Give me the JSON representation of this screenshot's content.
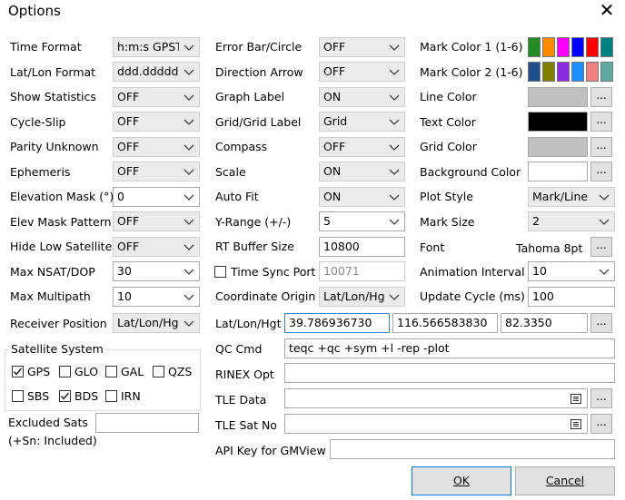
{
  "window": {
    "title": "Options"
  },
  "col1": {
    "time_format": {
      "label": "Time Format",
      "value": "h:m:s GPST"
    },
    "latlon_format": {
      "label": "Lat/Lon Format",
      "value": "ddd.ddddd"
    },
    "show_statistics": {
      "label": "Show Statistics",
      "value": "OFF"
    },
    "cycle_slip": {
      "label": "Cycle-Slip",
      "value": "OFF"
    },
    "parity_unknown": {
      "label": "Parity Unknown",
      "value": "OFF"
    },
    "ephemeris": {
      "label": "Ephemeris",
      "value": "OFF"
    },
    "elevation_mask": {
      "label": "Elevation Mask (°)",
      "value": "0"
    },
    "elev_mask_pattern": {
      "label": "Elev Mask Pattern",
      "value": "OFF"
    },
    "hide_low_satellite": {
      "label": "Hide Low Satellite",
      "value": "OFF"
    },
    "max_nsat_dop": {
      "label": "Max NSAT/DOP",
      "value": "30"
    },
    "max_multipath": {
      "label": "Max Multipath",
      "value": "10"
    },
    "receiver_position": {
      "label": "Receiver Position",
      "value": "Lat/Lon/Hg"
    }
  },
  "col2": {
    "error_bar": {
      "label": "Error Bar/Circle",
      "value": "OFF"
    },
    "direction_arrow": {
      "label": "Direction Arrow",
      "value": "OFF"
    },
    "graph_label": {
      "label": "Graph Label",
      "value": "ON"
    },
    "grid_label": {
      "label": "Grid/Grid Label",
      "value": "Grid"
    },
    "compass": {
      "label": "Compass",
      "value": "OFF"
    },
    "scale": {
      "label": "Scale",
      "value": "ON"
    },
    "auto_fit": {
      "label": "Auto Fit",
      "value": "ON"
    },
    "y_range": {
      "label": "Y-Range (+/-)",
      "value": "5"
    },
    "rt_buffer_size": {
      "label": "RT Buffer Size",
      "value": "10800"
    },
    "time_sync_port": {
      "label": "Time Sync Port",
      "value": "10071",
      "checked": false
    },
    "coordinate_origin": {
      "label": "Coordinate Origin",
      "value": "Lat/Lon/Hg"
    }
  },
  "col3": {
    "mark_color_1": {
      "label": "Mark Color 1 (1-6)",
      "colors": [
        "#228b22",
        "#ff8c00",
        "#ff00ff",
        "#0000ff",
        "#ff0000",
        "#008080"
      ]
    },
    "mark_color_2": {
      "label": "Mark Color 2 (1-6)",
      "colors": [
        "#1e4f8c",
        "#808000",
        "#8a2be2",
        "#1e90ff",
        "#f08080",
        "#5fa8a0"
      ]
    },
    "line_color": {
      "label": "Line Color",
      "color": "#c0c0c0",
      "btn": "..."
    },
    "text_color": {
      "label": "Text Color",
      "color": "#000000",
      "btn": "..."
    },
    "grid_color": {
      "label": "Grid Color",
      "color": "#c0c0c0",
      "btn": "..."
    },
    "background_color": {
      "label": "Background Color",
      "color": "#ffffff",
      "btn": "..."
    },
    "plot_style": {
      "label": "Plot Style",
      "value": "Mark/Line"
    },
    "mark_size": {
      "label": "Mark Size",
      "value": "2"
    },
    "font": {
      "label": "Font",
      "value": "Tahoma 8pt",
      "btn": "..."
    },
    "animation_interval": {
      "label": "Animation Interval",
      "value": "10"
    },
    "update_cycle": {
      "label": "Update Cycle (ms)",
      "value": "100"
    }
  },
  "latlonhgt": {
    "label": "Lat/Lon/Hgt",
    "lat": "39.786936730",
    "lon": "116.566583830",
    "hgt": "82.3350",
    "btn": "..."
  },
  "qc_cmd": {
    "label": "QC Cmd",
    "value": "teqc +qc +sym +l -rep -plot"
  },
  "rinex_opt": {
    "label": "RINEX Opt",
    "value": ""
  },
  "tle_data": {
    "label": "TLE Data",
    "value": "",
    "btn": "..."
  },
  "tle_sat_no": {
    "label": "TLE Sat No",
    "value": "",
    "btn": "..."
  },
  "api_key": {
    "label": "API Key for GMView",
    "value": ""
  },
  "satellite_system": {
    "title": "Satellite System",
    "gps": {
      "label": "GPS",
      "checked": true
    },
    "glo": {
      "label": "GLO",
      "checked": false
    },
    "gal": {
      "label": "GAL",
      "checked": false
    },
    "qzs": {
      "label": "QZS",
      "checked": false
    },
    "sbs": {
      "label": "SBS",
      "checked": false
    },
    "bds": {
      "label": "BDS",
      "checked": true
    },
    "irn": {
      "label": "IRN",
      "checked": false
    }
  },
  "excluded_sats": {
    "label_line1": "Excluded Sats",
    "label_line2": "(+Sn: Included)",
    "value": ""
  },
  "buttons": {
    "ok": "OK",
    "cancel": "Cancel"
  }
}
